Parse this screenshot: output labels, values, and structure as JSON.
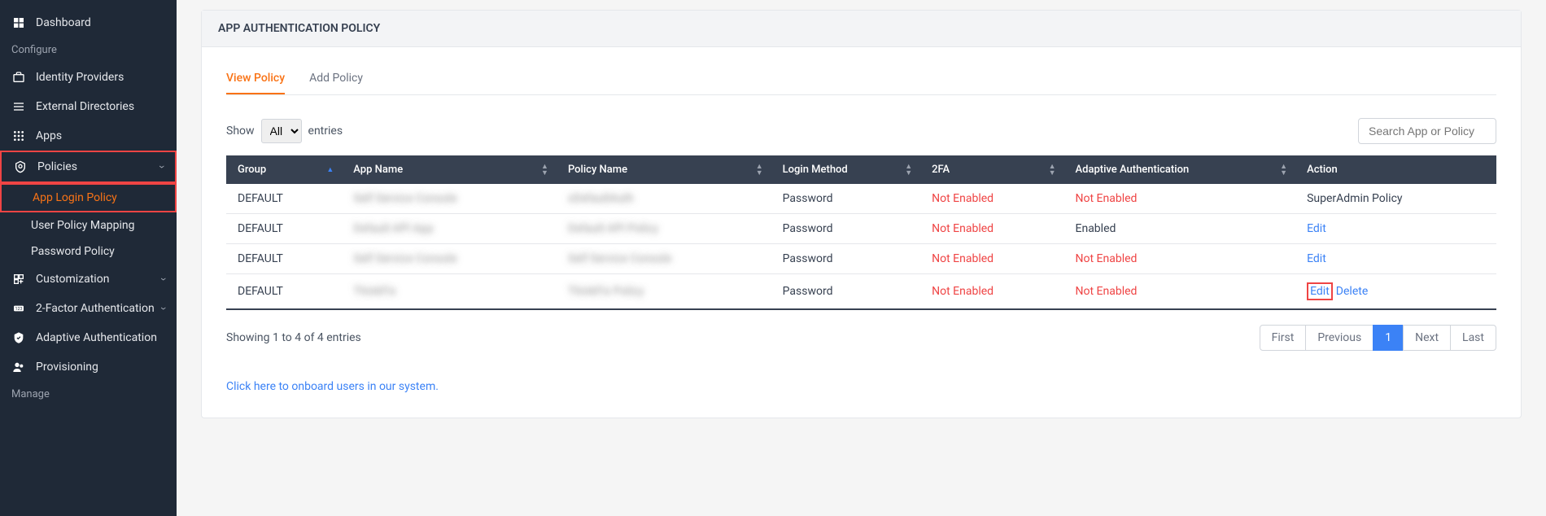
{
  "sidebar": {
    "items": [
      {
        "icon": "dashboard",
        "label": "Dashboard"
      },
      {
        "section": true,
        "label": "Configure"
      },
      {
        "icon": "briefcase",
        "label": "Identity Providers"
      },
      {
        "icon": "list",
        "label": "External Directories"
      },
      {
        "icon": "grid",
        "label": "Apps"
      },
      {
        "icon": "shield",
        "label": "Policies",
        "expandable": true,
        "highlighted": true
      },
      {
        "sub": true,
        "label": "App Login Policy",
        "active": true,
        "highlighted": true
      },
      {
        "sub": true,
        "label": "User Policy Mapping"
      },
      {
        "sub": true,
        "label": "Password Policy"
      },
      {
        "icon": "plus-square",
        "label": "Customization",
        "expandable": true
      },
      {
        "icon": "key",
        "label": "2-Factor Authentication",
        "expandable": true
      },
      {
        "icon": "check-shield",
        "label": "Adaptive Authentication"
      },
      {
        "icon": "users",
        "label": "Provisioning"
      },
      {
        "section": true,
        "label": "Manage"
      }
    ]
  },
  "page": {
    "title": "APP AUTHENTICATION POLICY",
    "tabs": [
      {
        "label": "View Policy",
        "active": true
      },
      {
        "label": "Add Policy"
      }
    ],
    "show_label": "Show",
    "entries_label": "entries",
    "entries_options": [
      "All"
    ],
    "entries_selected": "All",
    "search_placeholder": "Search App or Policy",
    "columns": [
      "Group",
      "App Name",
      "Policy Name",
      "Login Method",
      "2FA",
      "Adaptive Authentication",
      "Action"
    ],
    "rows": [
      {
        "group": "DEFAULT",
        "app": "Self Service Console",
        "policy": "xDefaultAuth",
        "login": "Password",
        "twofa": "Not Enabled",
        "adaptive": "Not Enabled",
        "action_type": "plain",
        "action": "SuperAdmin Policy"
      },
      {
        "group": "DEFAULT",
        "app": "Default API App",
        "policy": "Default API Policy",
        "login": "Password",
        "twofa": "Not Enabled",
        "adaptive": "Enabled",
        "action_type": "edit",
        "action": "Edit"
      },
      {
        "group": "DEFAULT",
        "app": "Self Service Console",
        "policy": "Self Service Console",
        "login": "Password",
        "twofa": "Not Enabled",
        "adaptive": "Not Enabled",
        "action_type": "edit",
        "action": "Edit"
      },
      {
        "group": "DEFAULT",
        "app": "ThinkFix",
        "policy": "ThinkFix Policy",
        "login": "Password",
        "twofa": "Not Enabled",
        "adaptive": "Not Enabled",
        "action_type": "edit-delete",
        "action": "Edit",
        "action2": "Delete"
      }
    ],
    "info": "Showing 1 to 4 of 4 entries",
    "pagination": {
      "first": "First",
      "prev": "Previous",
      "page": "1",
      "next": "Next",
      "last": "Last"
    },
    "onboard": "Click here to onboard users in our system."
  }
}
